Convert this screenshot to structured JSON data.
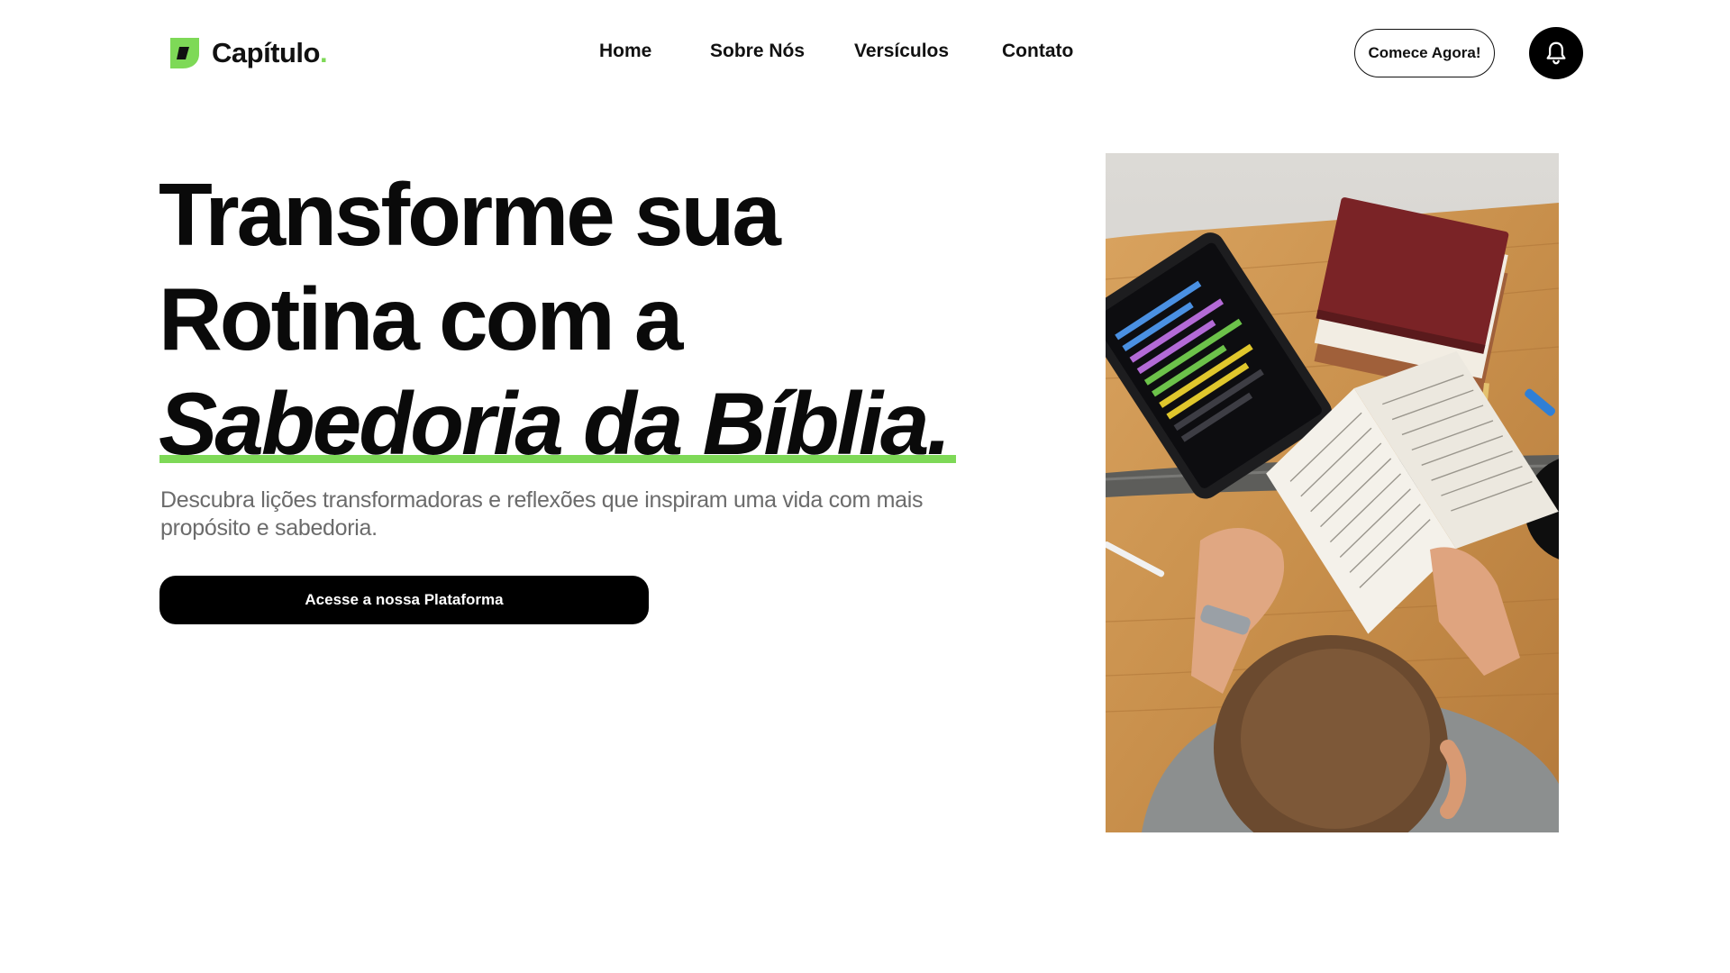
{
  "brand": {
    "name": "Capítulo",
    "dot": ".",
    "accent_color": "#7ed957"
  },
  "nav": {
    "items": [
      {
        "label": "Home"
      },
      {
        "label": "Sobre Nós"
      },
      {
        "label": "Versículos"
      },
      {
        "label": "Contato"
      }
    ]
  },
  "header": {
    "cta_label": "Comece Agora!",
    "notification_icon": "bell-icon"
  },
  "hero": {
    "title_line1": "Transforme sua",
    "title_line2": "Rotina com a",
    "title_line3": "Sabedoria da Bíblia.",
    "subtitle": "Descubra lições transformadoras e reflexões que inspiram uma vida com mais propósito e sabedoria.",
    "button_label": "Acesse a nossa Plataforma"
  },
  "colors": {
    "text": "#0a0a0a",
    "muted": "#6b6b6b",
    "button_bg": "#000000"
  }
}
